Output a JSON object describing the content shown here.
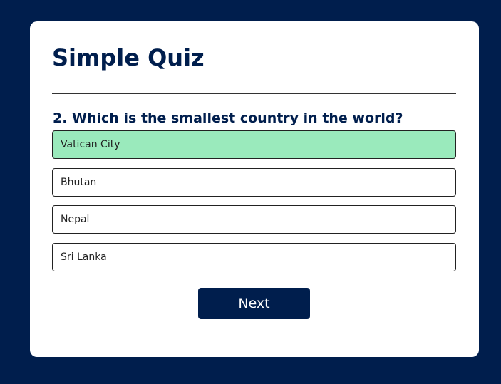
{
  "quiz": {
    "title": "Simple Quiz",
    "question": "2. Which is the smallest country in the world?",
    "answers": [
      {
        "label": "Vatican City",
        "state": "correct"
      },
      {
        "label": "Bhutan",
        "state": "default"
      },
      {
        "label": "Nepal",
        "state": "default"
      },
      {
        "label": "Sri Lanka",
        "state": "default"
      }
    ],
    "next_label": "Next"
  },
  "colors": {
    "background": "#001e4d",
    "card": "#ffffff",
    "accent": "#001e4d",
    "correct_answer": "#9aeabc"
  }
}
